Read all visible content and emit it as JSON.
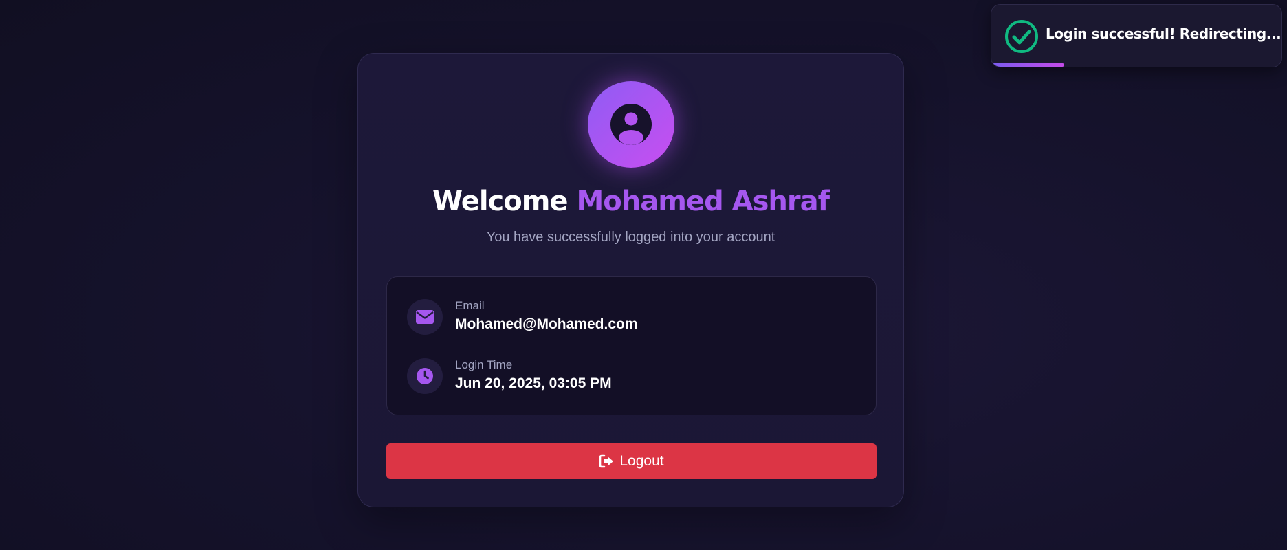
{
  "toast": {
    "icon": "check-circle-icon",
    "message": "Login successful! Redirecting...",
    "progress_percent": 25,
    "accent": "#10b981"
  },
  "card": {
    "avatar_icon": "user-circle-icon",
    "welcome_word": "Welcome",
    "user_name": "Mohamed Ashraf",
    "subtitle": "You have successfully logged into your account",
    "info": {
      "email": {
        "icon": "envelope-icon",
        "label": "Email",
        "value": "Mohamed@Mohamed.com"
      },
      "login_time": {
        "icon": "clock-icon",
        "label": "Login Time",
        "value": "Jun 20, 2025, 03:05 PM"
      }
    },
    "logout": {
      "icon": "sign-out-icon",
      "label": "Logout"
    }
  },
  "colors": {
    "accent": "#a557ef",
    "danger": "#dc3545",
    "success": "#10b981",
    "background": "#15122b"
  }
}
